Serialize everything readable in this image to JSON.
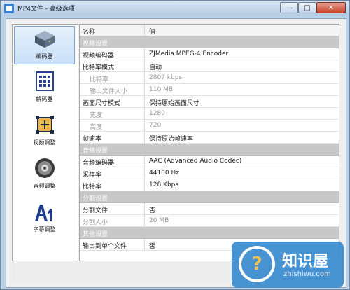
{
  "window": {
    "title": "MP4文件 - 高级选项"
  },
  "titlebar_buttons": {
    "minimize": "—",
    "maximize": "□",
    "close": "✕"
  },
  "sidebar": {
    "items": [
      {
        "label": "编码器",
        "icon": "encoder-icon",
        "selected": true
      },
      {
        "label": "解码器",
        "icon": "decoder-icon",
        "selected": false
      },
      {
        "label": "视频调整",
        "icon": "video-adjust-icon",
        "selected": false
      },
      {
        "label": "音频调整",
        "icon": "audio-adjust-icon",
        "selected": false
      },
      {
        "label": "字幕调整",
        "icon": "subtitle-adjust-icon",
        "selected": false
      }
    ]
  },
  "grid": {
    "headers": {
      "name": "名称",
      "value": "值"
    },
    "rows": [
      {
        "type": "section",
        "name": "视频设置",
        "value": ""
      },
      {
        "type": "item",
        "name": "视频编码器",
        "value": "ZJMedia MPEG-4 Encoder",
        "indent": false,
        "disabled": false
      },
      {
        "type": "item",
        "name": "比特率模式",
        "value": "自动",
        "indent": false,
        "disabled": false
      },
      {
        "type": "item",
        "name": "比特率",
        "value": "2807 kbps",
        "indent": true,
        "disabled": true
      },
      {
        "type": "item",
        "name": "输出文件大小",
        "value": "110 MB",
        "indent": true,
        "disabled": true
      },
      {
        "type": "item",
        "name": "画面尺寸模式",
        "value": "保持原始画面尺寸",
        "indent": false,
        "disabled": false
      },
      {
        "type": "item",
        "name": "宽度",
        "value": "1280",
        "indent": true,
        "disabled": true
      },
      {
        "type": "item",
        "name": "高度",
        "value": "720",
        "indent": true,
        "disabled": true
      },
      {
        "type": "item",
        "name": "帧速率",
        "value": "保持原始帧速率",
        "indent": false,
        "disabled": false
      },
      {
        "type": "section",
        "name": "音频设置",
        "value": ""
      },
      {
        "type": "item",
        "name": "音频编码器",
        "value": "AAC (Advanced Audio Codec)",
        "indent": false,
        "disabled": false
      },
      {
        "type": "item",
        "name": "采样率",
        "value": "44100 Hz",
        "indent": false,
        "disabled": false
      },
      {
        "type": "item",
        "name": "比特率",
        "value": "128 Kbps",
        "indent": false,
        "disabled": false
      },
      {
        "type": "section",
        "name": "分割设置",
        "value": ""
      },
      {
        "type": "item",
        "name": "分割文件",
        "value": "否",
        "indent": false,
        "disabled": false
      },
      {
        "type": "item",
        "name": "分割大小",
        "value": "20 MB",
        "indent": false,
        "disabled": true
      },
      {
        "type": "section",
        "name": "其他设置",
        "value": ""
      },
      {
        "type": "item",
        "name": "输出到单个文件",
        "value": "否",
        "indent": false,
        "disabled": false
      }
    ]
  },
  "watermark": {
    "text": "知识屋",
    "url": "zhishiwu.com",
    "badge": "?"
  },
  "colors": {
    "accent": "#3f8fd1",
    "section_bg": "#c8c8c8",
    "selected_bg": "#c9e0f7"
  }
}
